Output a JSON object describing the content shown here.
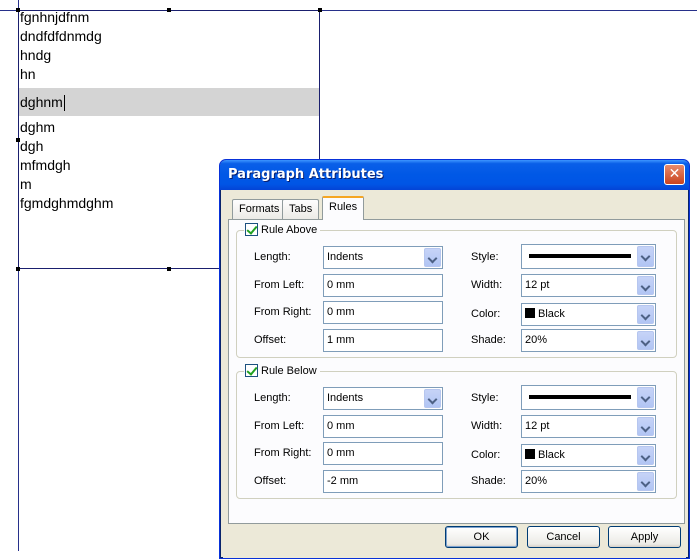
{
  "document": {
    "lines": [
      "fgnhnjdfnm",
      "dndfdfdnmdg",
      "hndg",
      "hn",
      "dghnm",
      "dghm",
      "dgh",
      "mfmdgh",
      "m",
      "fgmdghmdghm"
    ],
    "selected_index": 4
  },
  "dialog": {
    "title": "Paragraph Attributes",
    "close_glyph": "✕",
    "tabs": [
      {
        "label": "Formats",
        "active": false
      },
      {
        "label": "Tabs",
        "active": false
      },
      {
        "label": "Rules",
        "active": true
      }
    ],
    "rule_above": {
      "label": "Rule Above",
      "checked": true,
      "length_label": "Length:",
      "length_value": "Indents",
      "from_left_label": "From Left:",
      "from_left_value": "0 mm",
      "from_right_label": "From Right:",
      "from_right_value": "0 mm",
      "offset_label": "Offset:",
      "offset_value": "1 mm",
      "style_label": "Style:",
      "width_label": "Width:",
      "width_value": "12 pt",
      "color_label": "Color:",
      "color_value": "Black",
      "shade_label": "Shade:",
      "shade_value": "20%"
    },
    "rule_below": {
      "label": "Rule Below",
      "checked": true,
      "length_label": "Length:",
      "length_value": "Indents",
      "from_left_label": "From Left:",
      "from_left_value": "0 mm",
      "from_right_label": "From Right:",
      "from_right_value": "0 mm",
      "offset_label": "Offset:",
      "offset_value": "-2 mm",
      "style_label": "Style:",
      "width_label": "Width:",
      "width_value": "12 pt",
      "color_label": "Color:",
      "color_value": "Black",
      "shade_label": "Shade:",
      "shade_value": "20%"
    },
    "buttons": {
      "ok": "OK",
      "cancel": "Cancel",
      "apply": "Apply"
    }
  },
  "colors": {
    "titlebar": "#0055e5",
    "selection": "#d4d4d4",
    "guide": "#27308a",
    "rule_color": "#000000"
  }
}
